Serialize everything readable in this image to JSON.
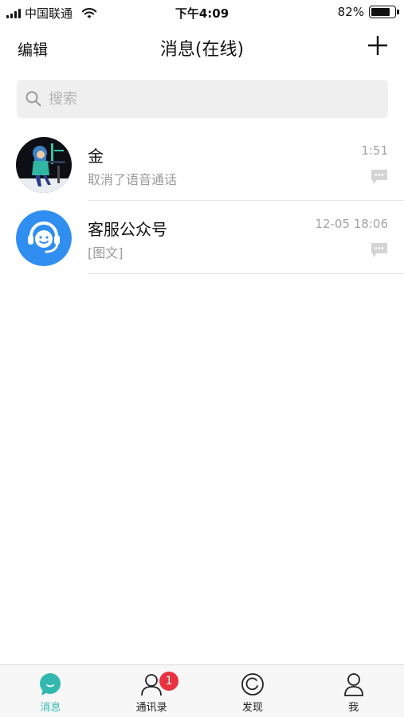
{
  "status_bar": {
    "carrier": "中国联通",
    "time": "下午4:09",
    "battery_percent": "82%",
    "battery_level": 0.82
  },
  "nav": {
    "edit_label": "编辑",
    "title": "消息(在线)",
    "add_icon": "plus-icon"
  },
  "search": {
    "placeholder": "搜索",
    "value": ""
  },
  "conversations": [
    {
      "name": "金",
      "preview": "取消了语音通话",
      "time": "1:51",
      "avatar": "illustrated-person-avatar"
    },
    {
      "name": "客服公众号",
      "preview": "[图文]",
      "time": "12-05 18:06",
      "avatar": "headset-service-avatar"
    }
  ],
  "tabs": [
    {
      "label": "消息",
      "icon": "chat-bubble-icon",
      "active": true
    },
    {
      "label": "通讯录",
      "icon": "contacts-icon",
      "badge": "1"
    },
    {
      "label": "发现",
      "icon": "discover-icon"
    },
    {
      "label": "我",
      "icon": "profile-icon"
    }
  ],
  "colors": {
    "accent": "#33b8b0",
    "badge": "#e8323f",
    "service_avatar": "#2f8ef0"
  }
}
